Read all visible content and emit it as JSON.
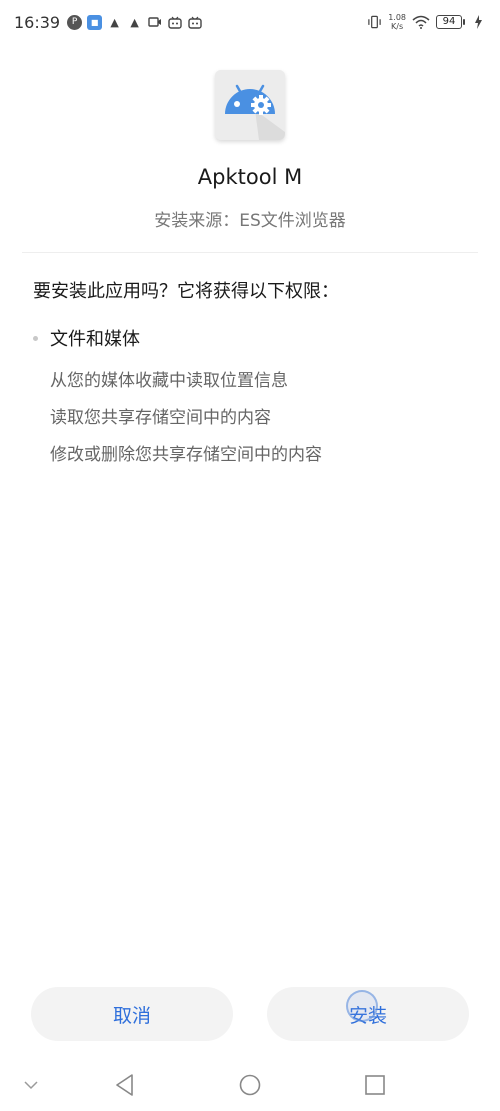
{
  "status_bar": {
    "time": "16:39",
    "net_speed_value": "1.08",
    "net_speed_unit": "K/s",
    "battery": "94",
    "left_icons": [
      "p-icon",
      "app-icon",
      "a-icon",
      "a-icon",
      "video-icon",
      "bilibili-icon",
      "bilibili-icon"
    ],
    "right_icons": [
      "vibrate-icon",
      "wifi-icon",
      "battery-icon",
      "charging-icon"
    ]
  },
  "app": {
    "name": "Apktool M",
    "source": "安装来源：ES文件浏览器",
    "icon": "android-gear-icon",
    "icon_color": "#4a90e2"
  },
  "prompt": "要安装此应用吗？它将获得以下权限：",
  "permission_group": {
    "title": "文件和媒体",
    "items": [
      "从您的媒体收藏中读取位置信息",
      "读取您共享存储空间中的内容",
      "修改或删除您共享存储空间中的内容"
    ]
  },
  "buttons": {
    "cancel": "取消",
    "install": "安装"
  },
  "colors": {
    "accent": "#2f6fdb",
    "button_bg": "#f3f3f3"
  },
  "nav_bar": {
    "icons": [
      "chevron-down-icon",
      "back-icon",
      "home-icon",
      "recents-icon"
    ]
  }
}
